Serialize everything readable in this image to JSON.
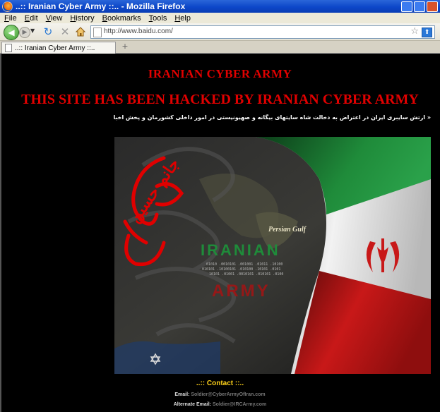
{
  "window": {
    "title": "..:: Iranian Cyber Army ::.. - Mozilla Firefox"
  },
  "menu": [
    "File",
    "Edit",
    "View",
    "History",
    "Bookmarks",
    "Tools",
    "Help"
  ],
  "nav": {
    "url": "http://www.baidu.com/"
  },
  "tabs": [
    {
      "label": "..:: Iranian Cyber Army ::.."
    }
  ],
  "page": {
    "heading": "IRANIAN CYBER ARMY",
    "subheading": "THIS SITE HAS BEEN HACKED BY IRANIAN CYBER ARMY",
    "persian_text": "« ارتش سایبری ایران در اعتراض به دخالت شاه سایتهای بیگانه و صهیونیستی در امور داخلی کشورمان و پخش اخبار دروغ و تفرقه برانگیز راه اندازی شده است »",
    "banner": {
      "map_label": "Persian Gulf",
      "logo_line1": "IRANIAN",
      "logo_line2": "ARMY",
      "calligraphy": "جانم حسین",
      "accent_red": "#e10000",
      "accent_green": "#1f8b3a"
    },
    "contact_title": "..:: Contact ::..",
    "email_label": "Email:",
    "email_value": "Soldier@CyberArmyOfIran.com",
    "alt_email_label": "Alternate Email:",
    "alt_email_value": "Soldier@IRCArmy.com"
  }
}
